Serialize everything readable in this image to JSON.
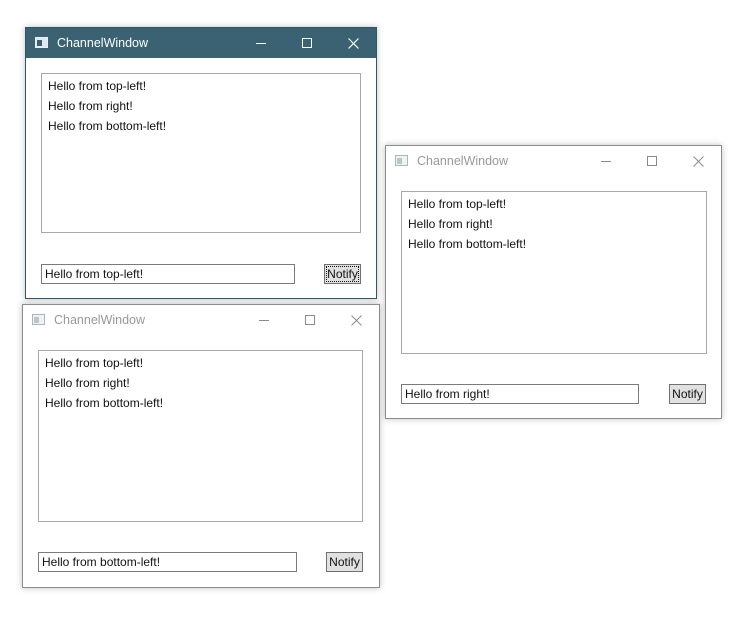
{
  "windows": [
    {
      "id": "top-left",
      "title": "ChannelWindow",
      "messages": [
        "Hello from top-left!",
        "Hello from right!",
        "Hello from bottom-left!"
      ],
      "input_value": "Hello from top-left!",
      "button_label": "Notify"
    },
    {
      "id": "bottom-left",
      "title": "ChannelWindow",
      "messages": [
        "Hello from top-left!",
        "Hello from right!",
        "Hello from bottom-left!"
      ],
      "input_value": "Hello from bottom-left!",
      "button_label": "Notify"
    },
    {
      "id": "right",
      "title": "ChannelWindow",
      "messages": [
        "Hello from top-left!",
        "Hello from right!",
        "Hello from bottom-left!"
      ],
      "input_value": "Hello from right!",
      "button_label": "Notify"
    }
  ],
  "colors": {
    "active_titlebar": "#3a6273",
    "inactive_title_text": "#999999",
    "button_face": "#e1e1e1"
  },
  "icons": {
    "app": "app-window-icon",
    "minimize": "minimize-icon",
    "maximize": "maximize-icon",
    "close": "close-icon"
  }
}
